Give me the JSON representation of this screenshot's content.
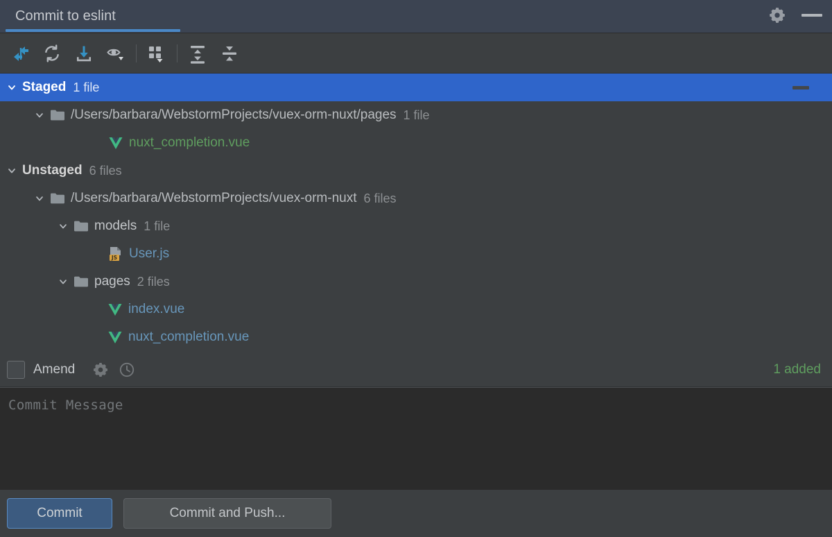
{
  "window": {
    "tab_title": "Commit to eslint",
    "settings_icon": "gear-icon",
    "minimize_icon": "minimize-icon",
    "accent_color": "#4a88c7",
    "selection_color": "#2f65ca"
  },
  "toolbar": {
    "buttons": [
      {
        "name": "stage-unstage-icon",
        "tooltip": "Stage / Unstage"
      },
      {
        "name": "refresh-icon",
        "tooltip": "Refresh Changes"
      },
      {
        "name": "revert-download-icon",
        "tooltip": "Revert"
      },
      {
        "name": "show-diff-eye-icon",
        "tooltip": "Show Diff"
      },
      {
        "name": "group-by-icon",
        "tooltip": "Group By"
      },
      {
        "name": "expand-all-icon",
        "tooltip": "Expand All"
      },
      {
        "name": "collapse-all-icon",
        "tooltip": "Collapse All"
      }
    ]
  },
  "tree": {
    "staged": {
      "label": "Staged",
      "count": "1 file",
      "selected": true,
      "path": "/Users/barbara/WebstormProjects/vuex-orm-nuxt/pages",
      "path_count": "1 file",
      "files": [
        {
          "name": "nuxt_completion.vue",
          "status": "added",
          "icon": "vue-file-icon"
        }
      ]
    },
    "unstaged": {
      "label": "Unstaged",
      "count": "6 files",
      "selected": false,
      "path": "/Users/barbara/WebstormProjects/vuex-orm-nuxt",
      "path_count": "6 files",
      "folders": [
        {
          "name": "models",
          "count": "1 file",
          "files": [
            {
              "name": "User.js",
              "status": "modified",
              "icon": "js-file-icon"
            }
          ]
        },
        {
          "name": "pages",
          "count": "2 files",
          "files": [
            {
              "name": "index.vue",
              "status": "modified",
              "icon": "vue-file-icon"
            },
            {
              "name": "nuxt_completion.vue",
              "status": "modified",
              "icon": "vue-file-icon"
            }
          ]
        }
      ]
    },
    "colors": {
      "added": "#5f9e5f",
      "modified": "#6897bb"
    }
  },
  "amend_bar": {
    "checkbox_label": "Amend",
    "checked": false,
    "settings_icon": "gear-icon",
    "history_icon": "clock-history-icon",
    "status_text": "1 added",
    "status_color": "#5f9e5f"
  },
  "commit_message": {
    "value": "",
    "placeholder": "Commit Message"
  },
  "actions": {
    "commit_label": "Commit",
    "commit_and_push_label": "Commit and Push..."
  }
}
